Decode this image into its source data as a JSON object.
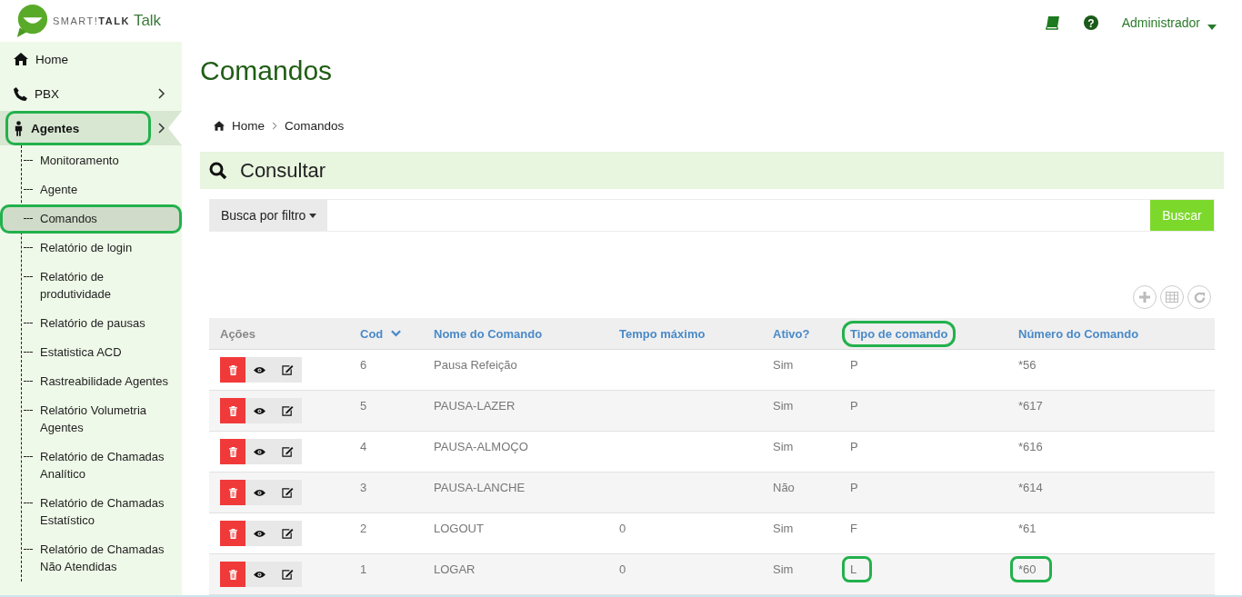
{
  "header": {
    "logo_text": "SMART!**TALK**",
    "logo_suffix": "Talk",
    "user": "Administrador",
    "help_icon": "?"
  },
  "sidebar": {
    "items": [
      {
        "label": "Home",
        "submenu": false,
        "selected": false,
        "highlighted": false
      },
      {
        "label": "PBX",
        "submenu": true,
        "selected": false,
        "highlighted": false
      },
      {
        "label": "Agentes",
        "submenu": true,
        "selected": true,
        "highlighted": true,
        "children": [
          {
            "label": "Monitoramento",
            "selected": false,
            "highlighted": false
          },
          {
            "label": "Agente",
            "selected": false,
            "highlighted": false
          },
          {
            "label": "Comandos",
            "selected": true,
            "highlighted": true
          },
          {
            "label": "Relatório de login",
            "selected": false,
            "highlighted": false
          },
          {
            "label": "Relatório de produtividade",
            "selected": false,
            "highlighted": false
          },
          {
            "label": "Relatório de pausas",
            "selected": false,
            "highlighted": false
          },
          {
            "label": "Estatistica ACD",
            "selected": false,
            "highlighted": false
          },
          {
            "label": "Rastreabilidade Agentes",
            "selected": false,
            "highlighted": false
          },
          {
            "label": "Relatório Volumetria Agentes",
            "selected": false,
            "highlighted": false
          },
          {
            "label": "Relatório de Chamadas Analítico",
            "selected": false,
            "highlighted": false
          },
          {
            "label": "Relatório de Chamadas Estatístico",
            "selected": false,
            "highlighted": false
          },
          {
            "label": "Relatório de Chamadas Não Atendidas",
            "selected": false,
            "highlighted": false
          }
        ]
      }
    ]
  },
  "page": {
    "title": "Comandos",
    "breadcrumb": [
      "Home",
      "Comandos"
    ],
    "panel_title": "Consultar",
    "filter_button": "Busca por filtro",
    "search_button": "Buscar"
  },
  "table": {
    "columns": [
      {
        "label": "Ações",
        "sortable": false,
        "sorted": false,
        "highlighted": false
      },
      {
        "label": "Cod",
        "sortable": true,
        "sorted": true,
        "highlighted": false
      },
      {
        "label": "Nome do Comando",
        "sortable": true,
        "sorted": false,
        "highlighted": false
      },
      {
        "label": "Tempo máximo",
        "sortable": true,
        "sorted": false,
        "highlighted": false
      },
      {
        "label": "Ativo?",
        "sortable": true,
        "sorted": false,
        "highlighted": false
      },
      {
        "label": "Tipo de comando",
        "sortable": true,
        "sorted": false,
        "highlighted": true
      },
      {
        "label": "Número do Comando",
        "sortable": true,
        "sorted": false,
        "highlighted": false
      }
    ],
    "rows": [
      {
        "cells": [
          {
            "kind": "actions"
          },
          {
            "kind": "text",
            "text": "6",
            "highlighted": false
          },
          {
            "kind": "text",
            "text": "Pausa Refeição",
            "highlighted": false
          },
          {
            "kind": "empty"
          },
          {
            "kind": "text",
            "text": "Sim",
            "highlighted": false
          },
          {
            "kind": "text",
            "text": "P",
            "highlighted": false
          },
          {
            "kind": "text",
            "text": "*56",
            "highlighted": false
          }
        ]
      },
      {
        "cells": [
          {
            "kind": "actions"
          },
          {
            "kind": "text",
            "text": "5",
            "highlighted": false
          },
          {
            "kind": "text",
            "text": "PAUSA-LAZER",
            "highlighted": false
          },
          {
            "kind": "empty"
          },
          {
            "kind": "text",
            "text": "Sim",
            "highlighted": false
          },
          {
            "kind": "text",
            "text": "P",
            "highlighted": false
          },
          {
            "kind": "text",
            "text": "*617",
            "highlighted": false
          }
        ]
      },
      {
        "cells": [
          {
            "kind": "actions"
          },
          {
            "kind": "text",
            "text": "4",
            "highlighted": false
          },
          {
            "kind": "text",
            "text": "PAUSA-ALMOÇO",
            "highlighted": false
          },
          {
            "kind": "empty"
          },
          {
            "kind": "text",
            "text": "Sim",
            "highlighted": false
          },
          {
            "kind": "text",
            "text": "P",
            "highlighted": false
          },
          {
            "kind": "text",
            "text": "*616",
            "highlighted": false
          }
        ]
      },
      {
        "cells": [
          {
            "kind": "actions"
          },
          {
            "kind": "text",
            "text": "3",
            "highlighted": false
          },
          {
            "kind": "text",
            "text": "PAUSA-LANCHE",
            "highlighted": false
          },
          {
            "kind": "empty"
          },
          {
            "kind": "text",
            "text": "Não",
            "highlighted": false
          },
          {
            "kind": "text",
            "text": "P",
            "highlighted": false
          },
          {
            "kind": "text",
            "text": "*614",
            "highlighted": false
          }
        ]
      },
      {
        "cells": [
          {
            "kind": "actions"
          },
          {
            "kind": "text",
            "text": "2",
            "highlighted": false
          },
          {
            "kind": "text",
            "text": "LOGOUT",
            "highlighted": false
          },
          {
            "kind": "text",
            "text": "0",
            "highlighted": false
          },
          {
            "kind": "text",
            "text": "Sim",
            "highlighted": false
          },
          {
            "kind": "text",
            "text": "F",
            "highlighted": false
          },
          {
            "kind": "text",
            "text": "*61",
            "highlighted": false
          }
        ]
      },
      {
        "cells": [
          {
            "kind": "actions"
          },
          {
            "kind": "text",
            "text": "1",
            "highlighted": false
          },
          {
            "kind": "text",
            "text": "LOGAR",
            "highlighted": false
          },
          {
            "kind": "text",
            "text": "0",
            "highlighted": false
          },
          {
            "kind": "text",
            "text": "Sim",
            "highlighted": false
          },
          {
            "kind": "text",
            "text": "L",
            "highlighted": true
          },
          {
            "kind": "text",
            "text": "*60",
            "highlighted": true
          }
        ]
      }
    ]
  }
}
